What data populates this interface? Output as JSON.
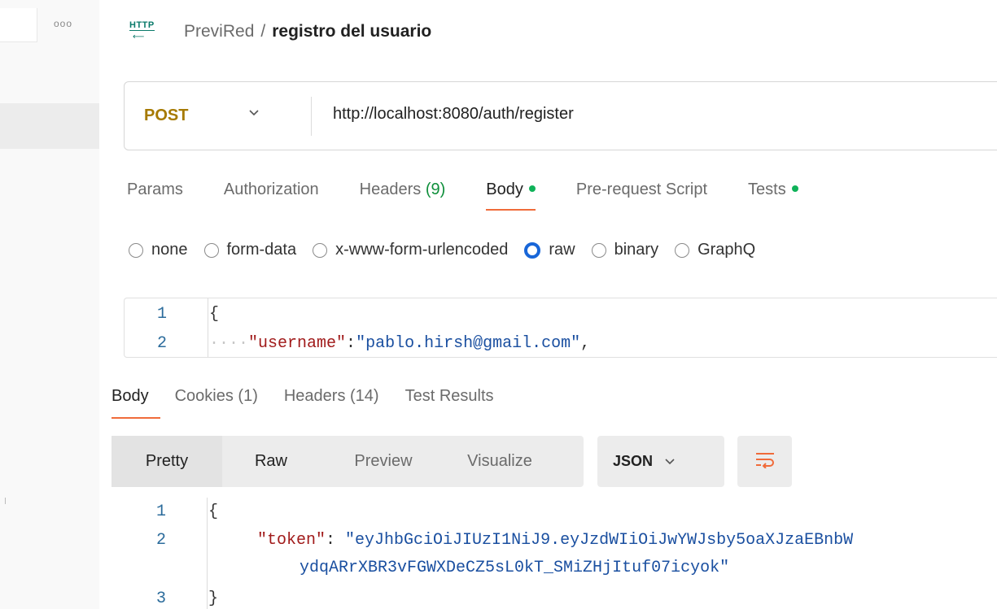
{
  "sidebar": {
    "more_label": "ooo"
  },
  "header": {
    "protocol_icon": "HTTP",
    "collection": "PreviRed",
    "separator": "/",
    "request_name": "registro del usuario"
  },
  "request": {
    "method": "POST",
    "url": "http://localhost:8080/auth/register",
    "tabs": [
      {
        "label": "Params"
      },
      {
        "label": "Authorization"
      },
      {
        "label": "Headers",
        "count": "(9)"
      },
      {
        "label": "Body",
        "dot": true
      },
      {
        "label": "Pre-request Script"
      },
      {
        "label": "Tests",
        "dot": true
      }
    ],
    "body_types": [
      "none",
      "form-data",
      "x-www-form-urlencoded",
      "raw",
      "binary",
      "GraphQ"
    ],
    "selected_body_type": "raw",
    "body_lines": [
      {
        "number": "1",
        "text": "{"
      },
      {
        "number": "2",
        "indent": "····",
        "key": "\"username\"",
        "colon": ":",
        "value": "\"pablo.hirsh@gmail.com\"",
        "comma": ","
      }
    ]
  },
  "response": {
    "tabs": [
      {
        "label": "Body"
      },
      {
        "label": "Cookies (1)"
      },
      {
        "label": "Headers (14)"
      },
      {
        "label": "Test Results"
      }
    ],
    "view_modes": [
      "Pretty",
      "Raw",
      "Preview",
      "Visualize"
    ],
    "format": "JSON",
    "lines": [
      {
        "number": "1",
        "text": "{"
      },
      {
        "number": "2",
        "key": "\"token\"",
        "colon": ": ",
        "value_part1": "\"eyJhbGciOiJIUzI1NiJ9.eyJzdWIiOiJwYWJsby5oaXJzaEBnbW",
        "value_part2": "ydqARrXBR3vFGWXDeCZ5sL0kT_SMiZHjItuf07icyok\""
      },
      {
        "number": "3",
        "text": "}"
      }
    ]
  },
  "colors": {
    "accent": "#f06b3a",
    "method": "#a67a00",
    "success_dot": "#0fb259",
    "radio_selected": "#1866d8"
  }
}
